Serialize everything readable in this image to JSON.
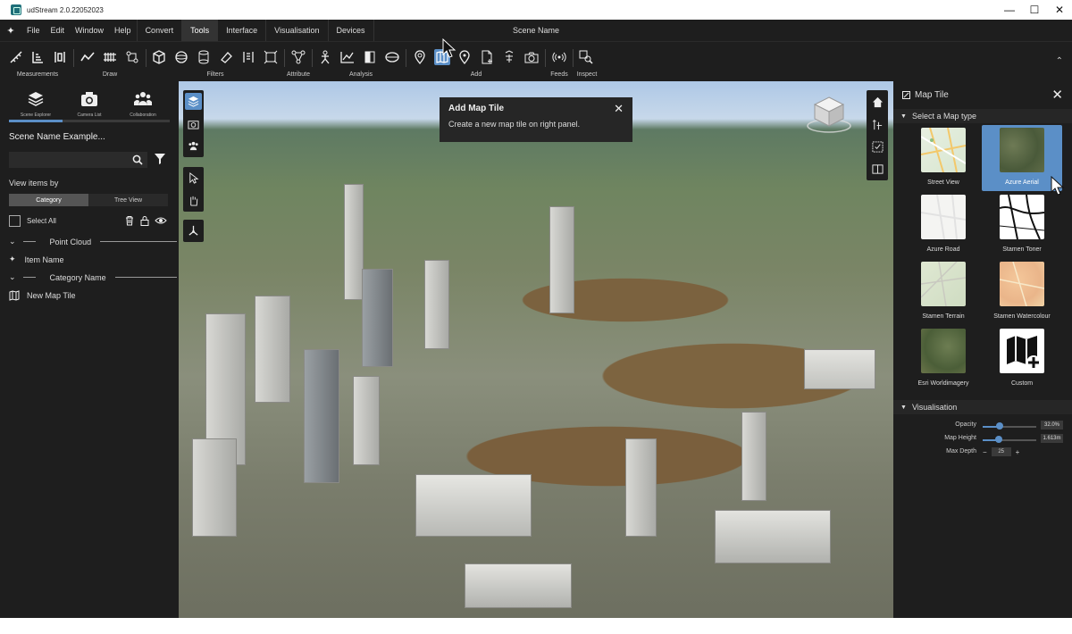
{
  "app": {
    "title": "udStream 2.0.22052023",
    "scene_name": "Scene Name"
  },
  "menu": {
    "items": [
      "File",
      "Edit",
      "Window",
      "Help"
    ],
    "tabs": [
      "Convert",
      "Tools",
      "Interface",
      "Visualisation",
      "Devices"
    ],
    "active_tab": "Tools"
  },
  "ribbon": {
    "groups": [
      "Measurements",
      "Draw",
      "Filters",
      "Attribute",
      "Analysis",
      "Add",
      "Feeds",
      "Inspect"
    ],
    "selected_tool": "add-map-tile-icon"
  },
  "left": {
    "tabs": [
      "Scene Explorer",
      "Camera List",
      "Collaboration"
    ],
    "scene_title": "Scene Name Example...",
    "search_placeholder": "",
    "view_by_label": "View items by",
    "view_options": [
      "Category",
      "Tree View"
    ],
    "select_all": "Select All",
    "tree": {
      "group1": "Point Cloud",
      "item1": "Item Name",
      "group2": "Category Name",
      "item2": "New Map Tile"
    }
  },
  "tooltip": {
    "title": "Add Map Tile",
    "body": "Create a new map tile on right panel."
  },
  "right": {
    "title": "Map Tile",
    "map_type_section": "Select a Map type",
    "tiles": [
      "Street View",
      "Azure Aerial",
      "Azure Road",
      "Stamen Toner",
      "Stamen Terrain",
      "Stamen Watercolour",
      "Esri Worldimagery",
      "Custom"
    ],
    "selected_tile": "Azure Aerial",
    "vis_section": "Visualisation",
    "opacity_label": "Opacity",
    "opacity_value": "32.0%",
    "opacity_fraction": 0.32,
    "height_label": "Map Height",
    "height_value": "1.613m",
    "height_fraction": 0.3,
    "depth_label": "Max Depth",
    "depth_value": "25"
  },
  "colors": {
    "accent": "#5b8fc7",
    "panel": "#1e1e1e",
    "water": "#7a5f3d"
  }
}
